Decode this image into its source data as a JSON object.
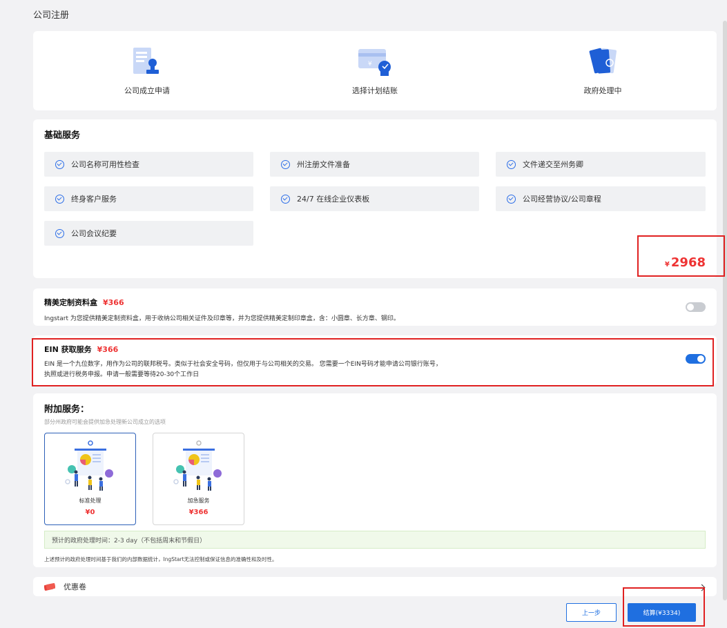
{
  "page": {
    "title": "公司注册"
  },
  "steps": [
    {
      "label": "公司成立申请",
      "icon": "document-stamp-icon"
    },
    {
      "label": "选择计划结账",
      "icon": "payment-card-icon"
    },
    {
      "label": "政府处理中",
      "icon": "government-files-icon"
    }
  ],
  "basic_services": {
    "title": "基础服务",
    "items": [
      {
        "label": "公司名称可用性检查"
      },
      {
        "label": "州注册文件准备"
      },
      {
        "label": "文件递交至州务卿"
      },
      {
        "label": "终身客户服务"
      },
      {
        "label": "24/7 在线企业仪表板"
      },
      {
        "label": "公司经营协议/公司章程"
      },
      {
        "label": "公司会议纪要"
      }
    ],
    "currency": "¥",
    "price": "2968"
  },
  "options": {
    "box": {
      "title": "精美定制资料盒",
      "price": "¥366",
      "desc": "Ingstart 为您提供精美定制资料盒，用于收纳公司相关证件及印章等，并为您提供精美定制印章盒，含：小圆章、长方章、钢印。",
      "enabled": false
    },
    "ein": {
      "title": "EIN 获取服务",
      "price": "¥366",
      "desc1": "EIN 是一个九位数字，用作为公司的联邦税号。类似于社会安全号码，但仅用于与公司相关的交易。 您需要一个EIN号码才能申请公司银行账号，",
      "desc2": "执照或进行税务申报。申请一般需要等待20-30个工作日",
      "enabled": true
    }
  },
  "extra": {
    "title": "附加服务：",
    "subtitle": "部分州政府可能会提供加急处理新公司成立的选项",
    "tiers": [
      {
        "name": "标准处理",
        "price": "¥0",
        "selected": true
      },
      {
        "name": "加急服务",
        "price": "¥366",
        "selected": false
      }
    ],
    "eta": "预计的政府处理时间：2-3 day（不包括周末和节假日）",
    "note": "上述预计的政府处理时间基于我们的内部数据统计，IngStart无法控制或保证信息的准确性和及时性。"
  },
  "coupon": {
    "label": "优惠卷",
    "icon": "coupon-ticket-icon"
  },
  "footer": {
    "prev_label": "上一步",
    "pay_label": "结算(¥3334)"
  },
  "colors": {
    "accent": "#1f6fe0",
    "price_red": "#ee3333",
    "highlight_box": "#e02020"
  }
}
